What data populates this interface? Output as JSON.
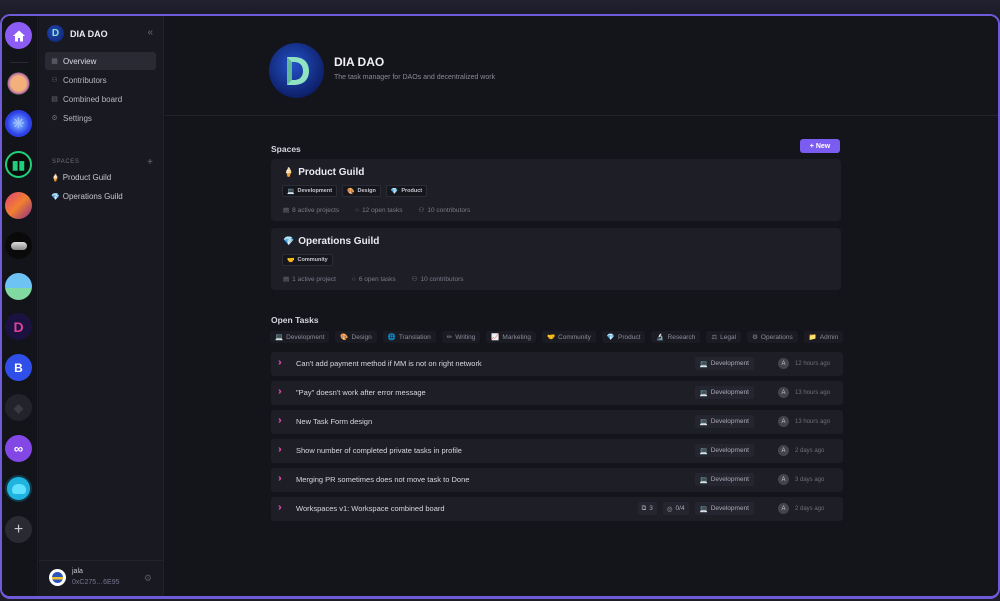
{
  "rail": {
    "home": {
      "icon": "home-icon",
      "color": "#8c5cf5"
    },
    "workspaces": [
      {
        "name": "workspace-orb",
        "icon": "orb-avatar"
      },
      {
        "name": "workspace-blue-burst",
        "icon": "burst-avatar"
      },
      {
        "name": "workspace-green-chart",
        "icon": "chart-avatar"
      },
      {
        "name": "workspace-stripes",
        "icon": "stripes-avatar"
      },
      {
        "name": "workspace-metal",
        "icon": "metal-avatar"
      },
      {
        "name": "workspace-sky",
        "icon": "sky-avatar"
      },
      {
        "name": "workspace-dia",
        "icon": "d-logo-avatar"
      },
      {
        "name": "workspace-b",
        "label": "B"
      },
      {
        "name": "workspace-fox",
        "icon": "fox-avatar"
      },
      {
        "name": "workspace-polygon",
        "icon": "polygon-avatar"
      },
      {
        "name": "workspace-elephant",
        "icon": "elephant-avatar"
      }
    ],
    "add_label": "+"
  },
  "sidebar": {
    "org_name": "DIA DAO",
    "logo_letter": "D",
    "collapse_icon": "«",
    "nav": [
      {
        "label": "Overview",
        "icon": "▦",
        "active": true
      },
      {
        "label": "Contributors",
        "icon": "⚇"
      },
      {
        "label": "Combined board",
        "icon": "▤"
      },
      {
        "label": "Settings",
        "icon": "⚙"
      }
    ],
    "spaces_label": "SPACES",
    "spaces_add": "+",
    "spaces": [
      {
        "emoji": "🍦",
        "label": "Product Guild"
      },
      {
        "emoji": "💎",
        "label": "Operations Guild"
      }
    ],
    "user": {
      "name": "jala",
      "address": "0xC275…6E95",
      "settings_icon": "⚙"
    }
  },
  "header": {
    "title": "DIA DAO",
    "description": "The task manager for DAOs and decentralized work"
  },
  "spaces_section": {
    "title": "Spaces",
    "new_button": "+ New",
    "cards": [
      {
        "emoji": "🍦",
        "title": "Product Guild",
        "tags": [
          {
            "icon": "💻",
            "label": "Development"
          },
          {
            "icon": "🎨",
            "label": "Design"
          },
          {
            "icon": "💎",
            "label": "Product"
          }
        ],
        "stats": {
          "projects": "8 active projects",
          "tasks": "12 open tasks",
          "contributors": "10 contributors"
        }
      },
      {
        "emoji": "💎",
        "title": "Operations Guild",
        "tags": [
          {
            "icon": "🤝",
            "label": "Community"
          }
        ],
        "stats": {
          "projects": "1 active project",
          "tasks": "6 open tasks",
          "contributors": "10 contributors"
        }
      }
    ]
  },
  "tasks_section": {
    "title": "Open Tasks",
    "filters": [
      {
        "icon": "💻",
        "label": "Development"
      },
      {
        "icon": "🎨",
        "label": "Design"
      },
      {
        "icon": "🌐",
        "label": "Translation"
      },
      {
        "icon": "✏",
        "label": "Writing"
      },
      {
        "icon": "📈",
        "label": "Marketing"
      },
      {
        "icon": "🤝",
        "label": "Community"
      },
      {
        "icon": "💎",
        "label": "Product"
      },
      {
        "icon": "🔬",
        "label": "Research"
      },
      {
        "icon": "⚖",
        "label": "Legal"
      },
      {
        "icon": "⚙",
        "label": "Operations"
      },
      {
        "icon": "📁",
        "label": "Admin"
      }
    ],
    "tasks": [
      {
        "title": "Can't add payment method if MM is not on right network",
        "tag": "Development",
        "assignee": "A",
        "time": "12 hours ago"
      },
      {
        "title": "\"Pay\" doesn't work after error message",
        "tag": "Development",
        "assignee": "A",
        "time": "13 hours ago"
      },
      {
        "title": "New Task Form design",
        "tag": "Development",
        "assignee": "A",
        "time": "13 hours ago"
      },
      {
        "title": "Show number of completed private tasks in profile",
        "tag": "Development",
        "assignee": "A",
        "time": "2 days ago"
      },
      {
        "title": "Merging PR sometimes does not move task to Done",
        "tag": "Development",
        "assignee": "A",
        "time": "3 days ago"
      },
      {
        "title": "Workspaces v1: Workspace combined board",
        "tag": "Development",
        "assignee": "A",
        "time": "2 days ago",
        "subtasks": "3",
        "checklist": "0/4"
      }
    ]
  }
}
